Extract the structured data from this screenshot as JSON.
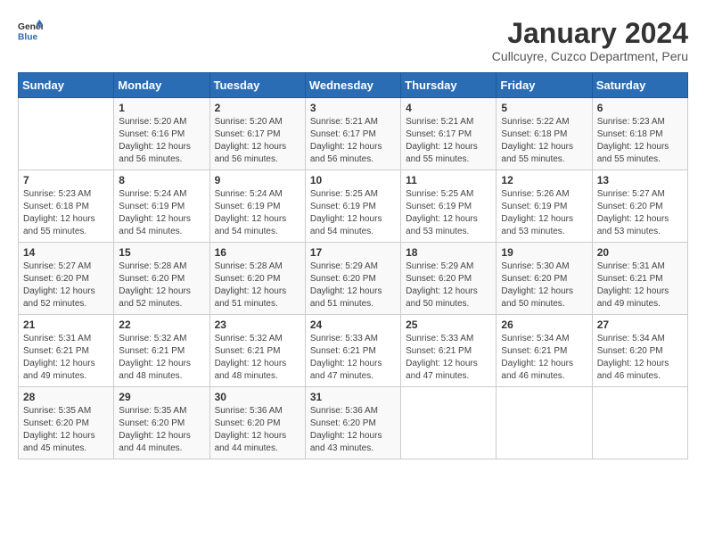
{
  "logo": {
    "general": "General",
    "blue": "Blue"
  },
  "title": "January 2024",
  "subtitle": "Cullcuyre, Cuzco Department, Peru",
  "days_of_week": [
    "Sunday",
    "Monday",
    "Tuesday",
    "Wednesday",
    "Thursday",
    "Friday",
    "Saturday"
  ],
  "weeks": [
    [
      {
        "day": "",
        "sunrise": "",
        "sunset": "",
        "daylight": ""
      },
      {
        "day": "1",
        "sunrise": "Sunrise: 5:20 AM",
        "sunset": "Sunset: 6:16 PM",
        "daylight": "Daylight: 12 hours and 56 minutes."
      },
      {
        "day": "2",
        "sunrise": "Sunrise: 5:20 AM",
        "sunset": "Sunset: 6:17 PM",
        "daylight": "Daylight: 12 hours and 56 minutes."
      },
      {
        "day": "3",
        "sunrise": "Sunrise: 5:21 AM",
        "sunset": "Sunset: 6:17 PM",
        "daylight": "Daylight: 12 hours and 56 minutes."
      },
      {
        "day": "4",
        "sunrise": "Sunrise: 5:21 AM",
        "sunset": "Sunset: 6:17 PM",
        "daylight": "Daylight: 12 hours and 55 minutes."
      },
      {
        "day": "5",
        "sunrise": "Sunrise: 5:22 AM",
        "sunset": "Sunset: 6:18 PM",
        "daylight": "Daylight: 12 hours and 55 minutes."
      },
      {
        "day": "6",
        "sunrise": "Sunrise: 5:23 AM",
        "sunset": "Sunset: 6:18 PM",
        "daylight": "Daylight: 12 hours and 55 minutes."
      }
    ],
    [
      {
        "day": "7",
        "sunrise": "Sunrise: 5:23 AM",
        "sunset": "Sunset: 6:18 PM",
        "daylight": "Daylight: 12 hours and 55 minutes."
      },
      {
        "day": "8",
        "sunrise": "Sunrise: 5:24 AM",
        "sunset": "Sunset: 6:19 PM",
        "daylight": "Daylight: 12 hours and 54 minutes."
      },
      {
        "day": "9",
        "sunrise": "Sunrise: 5:24 AM",
        "sunset": "Sunset: 6:19 PM",
        "daylight": "Daylight: 12 hours and 54 minutes."
      },
      {
        "day": "10",
        "sunrise": "Sunrise: 5:25 AM",
        "sunset": "Sunset: 6:19 PM",
        "daylight": "Daylight: 12 hours and 54 minutes."
      },
      {
        "day": "11",
        "sunrise": "Sunrise: 5:25 AM",
        "sunset": "Sunset: 6:19 PM",
        "daylight": "Daylight: 12 hours and 53 minutes."
      },
      {
        "day": "12",
        "sunrise": "Sunrise: 5:26 AM",
        "sunset": "Sunset: 6:19 PM",
        "daylight": "Daylight: 12 hours and 53 minutes."
      },
      {
        "day": "13",
        "sunrise": "Sunrise: 5:27 AM",
        "sunset": "Sunset: 6:20 PM",
        "daylight": "Daylight: 12 hours and 53 minutes."
      }
    ],
    [
      {
        "day": "14",
        "sunrise": "Sunrise: 5:27 AM",
        "sunset": "Sunset: 6:20 PM",
        "daylight": "Daylight: 12 hours and 52 minutes."
      },
      {
        "day": "15",
        "sunrise": "Sunrise: 5:28 AM",
        "sunset": "Sunset: 6:20 PM",
        "daylight": "Daylight: 12 hours and 52 minutes."
      },
      {
        "day": "16",
        "sunrise": "Sunrise: 5:28 AM",
        "sunset": "Sunset: 6:20 PM",
        "daylight": "Daylight: 12 hours and 51 minutes."
      },
      {
        "day": "17",
        "sunrise": "Sunrise: 5:29 AM",
        "sunset": "Sunset: 6:20 PM",
        "daylight": "Daylight: 12 hours and 51 minutes."
      },
      {
        "day": "18",
        "sunrise": "Sunrise: 5:29 AM",
        "sunset": "Sunset: 6:20 PM",
        "daylight": "Daylight: 12 hours and 50 minutes."
      },
      {
        "day": "19",
        "sunrise": "Sunrise: 5:30 AM",
        "sunset": "Sunset: 6:20 PM",
        "daylight": "Daylight: 12 hours and 50 minutes."
      },
      {
        "day": "20",
        "sunrise": "Sunrise: 5:31 AM",
        "sunset": "Sunset: 6:21 PM",
        "daylight": "Daylight: 12 hours and 49 minutes."
      }
    ],
    [
      {
        "day": "21",
        "sunrise": "Sunrise: 5:31 AM",
        "sunset": "Sunset: 6:21 PM",
        "daylight": "Daylight: 12 hours and 49 minutes."
      },
      {
        "day": "22",
        "sunrise": "Sunrise: 5:32 AM",
        "sunset": "Sunset: 6:21 PM",
        "daylight": "Daylight: 12 hours and 48 minutes."
      },
      {
        "day": "23",
        "sunrise": "Sunrise: 5:32 AM",
        "sunset": "Sunset: 6:21 PM",
        "daylight": "Daylight: 12 hours and 48 minutes."
      },
      {
        "day": "24",
        "sunrise": "Sunrise: 5:33 AM",
        "sunset": "Sunset: 6:21 PM",
        "daylight": "Daylight: 12 hours and 47 minutes."
      },
      {
        "day": "25",
        "sunrise": "Sunrise: 5:33 AM",
        "sunset": "Sunset: 6:21 PM",
        "daylight": "Daylight: 12 hours and 47 minutes."
      },
      {
        "day": "26",
        "sunrise": "Sunrise: 5:34 AM",
        "sunset": "Sunset: 6:21 PM",
        "daylight": "Daylight: 12 hours and 46 minutes."
      },
      {
        "day": "27",
        "sunrise": "Sunrise: 5:34 AM",
        "sunset": "Sunset: 6:20 PM",
        "daylight": "Daylight: 12 hours and 46 minutes."
      }
    ],
    [
      {
        "day": "28",
        "sunrise": "Sunrise: 5:35 AM",
        "sunset": "Sunset: 6:20 PM",
        "daylight": "Daylight: 12 hours and 45 minutes."
      },
      {
        "day": "29",
        "sunrise": "Sunrise: 5:35 AM",
        "sunset": "Sunset: 6:20 PM",
        "daylight": "Daylight: 12 hours and 44 minutes."
      },
      {
        "day": "30",
        "sunrise": "Sunrise: 5:36 AM",
        "sunset": "Sunset: 6:20 PM",
        "daylight": "Daylight: 12 hours and 44 minutes."
      },
      {
        "day": "31",
        "sunrise": "Sunrise: 5:36 AM",
        "sunset": "Sunset: 6:20 PM",
        "daylight": "Daylight: 12 hours and 43 minutes."
      },
      {
        "day": "",
        "sunrise": "",
        "sunset": "",
        "daylight": ""
      },
      {
        "day": "",
        "sunrise": "",
        "sunset": "",
        "daylight": ""
      },
      {
        "day": "",
        "sunrise": "",
        "sunset": "",
        "daylight": ""
      }
    ]
  ]
}
